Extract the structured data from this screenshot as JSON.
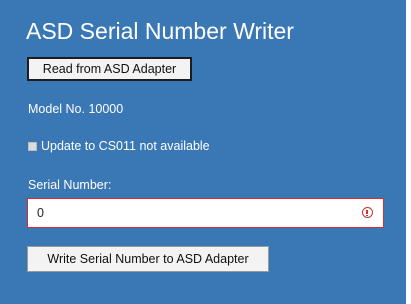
{
  "app": {
    "title": "ASD Serial Number Writer"
  },
  "actions": {
    "read_label": "Read from ASD Adapter",
    "write_label": "Write Serial Number to ASD Adapter"
  },
  "device": {
    "model_text": "Model No. 10000",
    "update_text": "Update to CS011 not available"
  },
  "serial": {
    "label": "Serial Number:",
    "value": "0"
  },
  "colors": {
    "panel_background": "#3a77b5",
    "error": "#d32f2f"
  },
  "icons": {
    "error": "error-icon"
  }
}
